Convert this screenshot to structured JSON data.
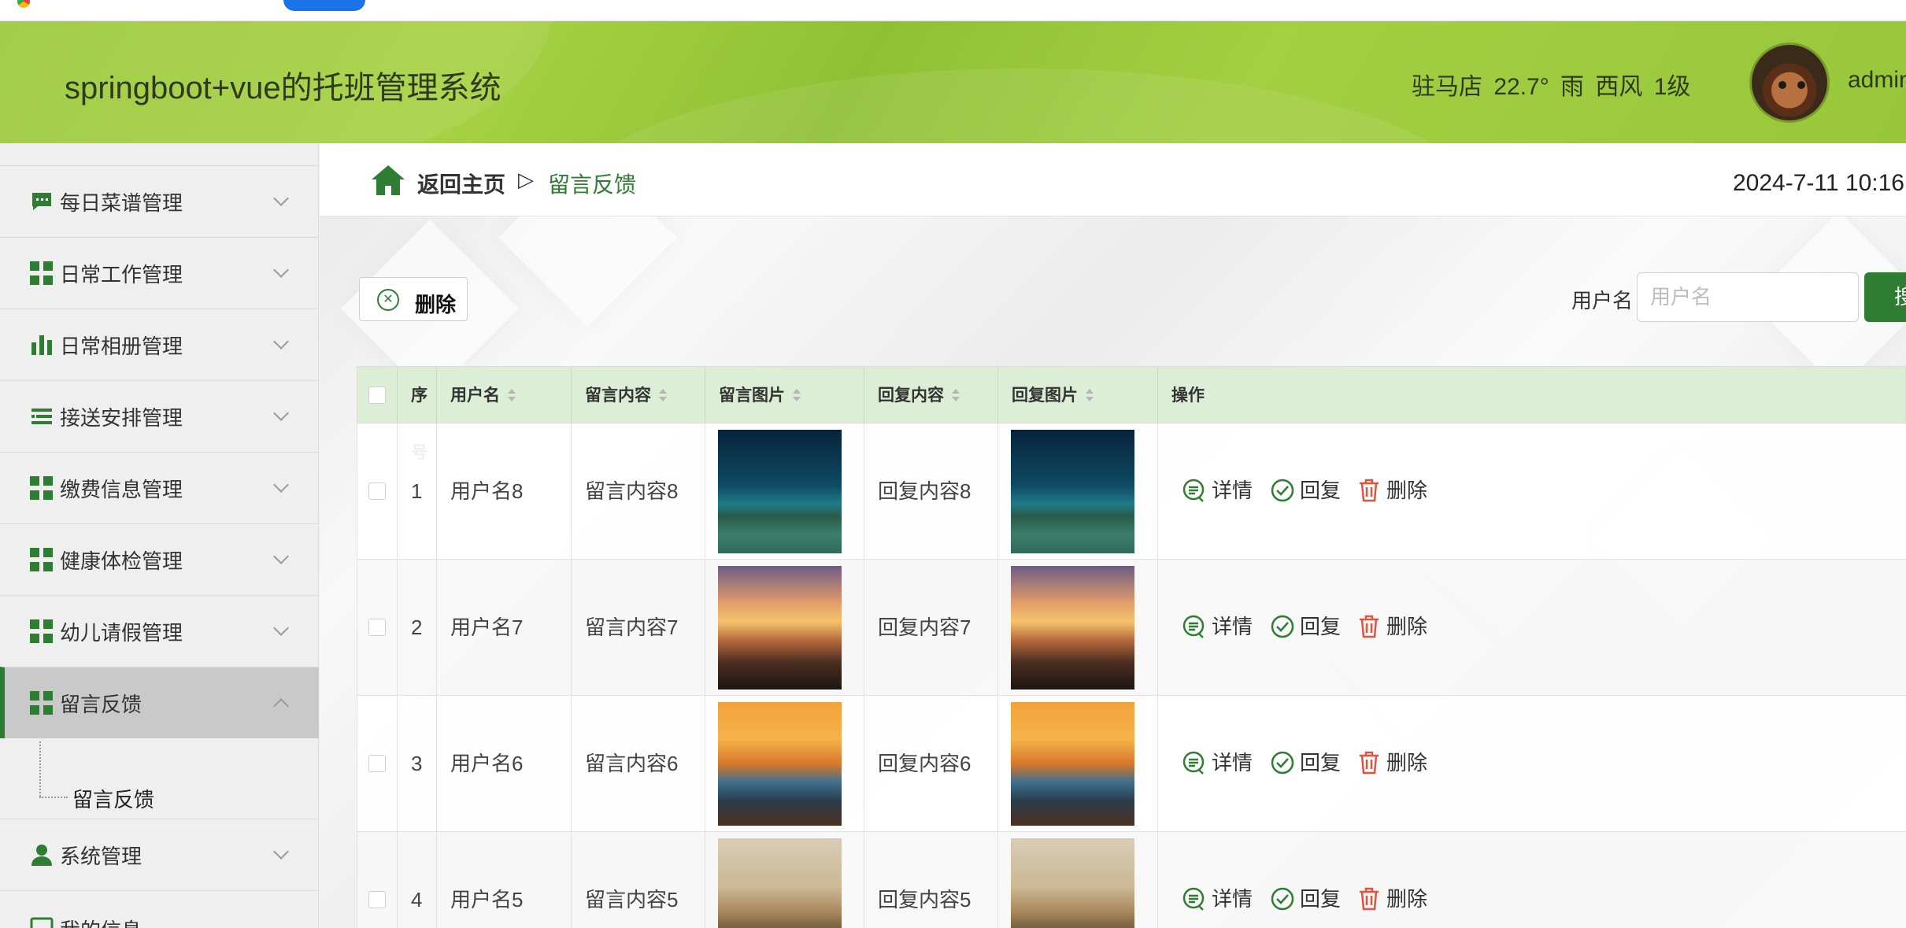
{
  "app": {
    "title": "springboot+vue的托班管理系统",
    "weather": "驻马店 22.7° 雨 西风 1级",
    "username": "admin"
  },
  "sidebar": {
    "items": [
      {
        "label": "每日菜谱管理",
        "icon": "chat-icon"
      },
      {
        "label": "日常工作管理",
        "icon": "grid-icon"
      },
      {
        "label": "日常相册管理",
        "icon": "bar-chart-icon"
      },
      {
        "label": "接送安排管理",
        "icon": "list-icon"
      },
      {
        "label": "缴费信息管理",
        "icon": "grid-icon"
      },
      {
        "label": "健康体检管理",
        "icon": "grid-icon"
      },
      {
        "label": "幼儿请假管理",
        "icon": "grid-icon"
      },
      {
        "label": "留言反馈",
        "icon": "grid-icon",
        "active": true
      },
      {
        "label": "系统管理",
        "icon": "user-icon"
      },
      {
        "label": "我的信息",
        "icon": "monitor-icon"
      }
    ],
    "submenu_label": "留言反馈"
  },
  "breadcrumb": {
    "home": "返回主页",
    "separator": "▷",
    "current": "留言反馈"
  },
  "datetime": "2024-7-11 10:16",
  "toolbar": {
    "delete_label": "删除",
    "search_label": "用户名",
    "search_placeholder": "用户名",
    "search_button": "搜"
  },
  "table": {
    "headers": [
      "序号",
      "用户名",
      "留言内容",
      "留言图片",
      "回复内容",
      "回复图片",
      "操作"
    ],
    "rows": [
      {
        "index": "1",
        "username": "用户名8",
        "message": "留言内容8",
        "reply": "回复内容8",
        "image": "starry-lake-photo"
      },
      {
        "index": "2",
        "username": "用户名7",
        "message": "留言内容7",
        "reply": "回复内容7",
        "image": "beach-sunset-photo"
      },
      {
        "index": "3",
        "username": "用户名6",
        "message": "留言内容6",
        "reply": "回复内容6",
        "image": "sea-rocks-sunset-photo"
      },
      {
        "index": "4",
        "username": "用户名5",
        "message": "留言内容5",
        "reply": "回复内容5",
        "image": "hikers-photo"
      }
    ],
    "actions": {
      "detail": "详情",
      "reply": "回复",
      "delete": "删除"
    }
  },
  "colors": {
    "header_green": "#9bc93a",
    "accent_green": "#2e7d32",
    "table_header": "#dcefd6",
    "delete_red": "#e0533f"
  }
}
